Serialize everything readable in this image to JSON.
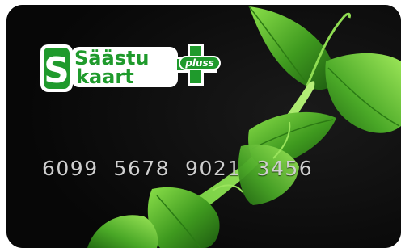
{
  "card": {
    "logo": {
      "line1": "Säästu",
      "line2": "kaart",
      "badge": "pluss",
      "icon": "plus-cross-icon"
    },
    "number": "6099  5678  9021  3456"
  },
  "colors": {
    "card_background": "#0c0c0c",
    "brand_green": "#1f9a2c",
    "leaf_green": "#4caf2a",
    "stem_green": "#7ddc3a",
    "number_text": "#cfcfcf"
  }
}
